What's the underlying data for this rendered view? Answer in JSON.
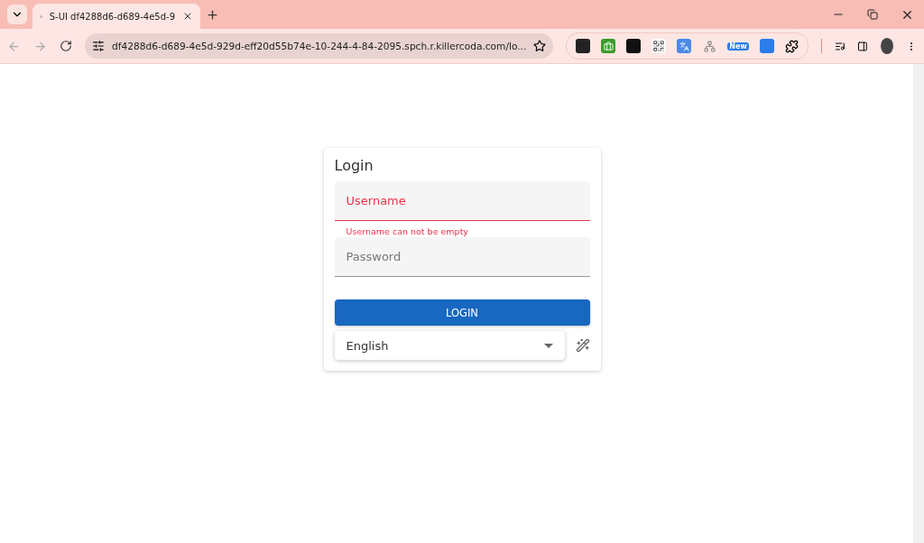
{
  "browser": {
    "tab": {
      "title": "S-UI df4288d6-d689-4e5d-9",
      "selected": true
    },
    "url": "df4288d6-d689-4e5d-929d-eff20d55b74e-10-244-4-84-2095.spch.r.killercoda.com/lo...",
    "extension_badge": "New"
  },
  "login": {
    "title": "Login",
    "fields": [
      {
        "placeholder": "Username",
        "error": true,
        "message": "Username can not be empty"
      },
      {
        "placeholder": "Password",
        "error": false
      }
    ],
    "button": "LOGIN",
    "language": {
      "value": "English"
    }
  }
}
